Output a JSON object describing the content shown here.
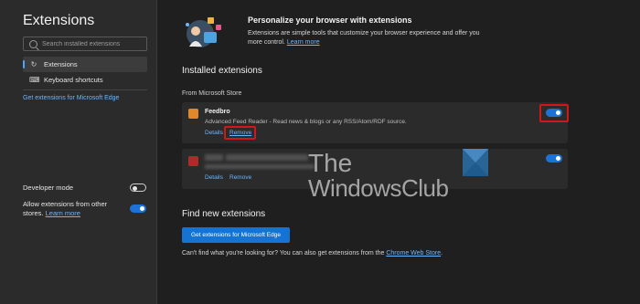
{
  "sidebar": {
    "title": "Extensions",
    "search_placeholder": "Search installed extensions",
    "nav": [
      {
        "label": "Extensions",
        "icon": "extensions-icon"
      },
      {
        "label": "Keyboard shortcuts",
        "icon": "keyboard-icon"
      }
    ],
    "get_link": "Get extensions for Microsoft Edge",
    "developer_mode": {
      "label": "Developer mode",
      "enabled": false
    },
    "allow_other": {
      "label": "Allow extensions from other stores.",
      "link": "Learn more",
      "enabled": true
    }
  },
  "hero": {
    "title": "Personalize your browser with extensions",
    "description": "Extensions are simple tools that customize your browser experience and offer you more control.",
    "link": "Learn more"
  },
  "installed": {
    "title": "Installed extensions",
    "source_label": "From Microsoft Store",
    "extensions": [
      {
        "name": "Feedbro",
        "description": "Advanced Feed Reader - Read news & blogs or any RSS/Atom/RDF source.",
        "details_label": "Details",
        "remove_label": "Remove",
        "enabled": true,
        "icon_color": "#e0892a"
      },
      {
        "name": "",
        "description": "",
        "details_label": "Details",
        "remove_label": "Remove",
        "enabled": true,
        "icon_color": "#b02a2a"
      }
    ]
  },
  "find": {
    "title": "Find new extensions",
    "button_label": "Get extensions for Microsoft Edge",
    "footer_text": "Can't find what you're looking for? You can also get extensions from the",
    "footer_link": "Chrome Web Store",
    "footer_end": "."
  },
  "watermark": {
    "line1": "The",
    "line2": "WindowsClub"
  },
  "colors": {
    "accent": "#1d72d8",
    "link": "#6cb6ff",
    "highlight": "#d01818"
  }
}
